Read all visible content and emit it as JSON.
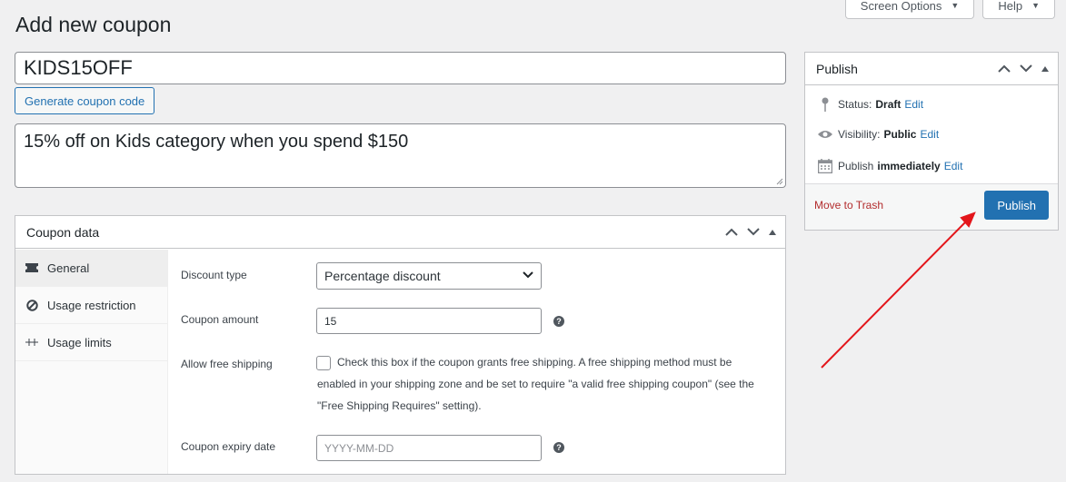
{
  "screen_meta": {
    "screen_options": "Screen Options",
    "help": "Help"
  },
  "page": {
    "title": "Add new coupon"
  },
  "coupon": {
    "code": "KIDS15OFF",
    "generate_label": "Generate coupon code",
    "description": "15% off on Kids category when you spend $150"
  },
  "coupon_data": {
    "title": "Coupon data",
    "tabs": [
      {
        "label": "General",
        "icon": "ticket-icon"
      },
      {
        "label": "Usage restriction",
        "icon": "prohibited-icon"
      },
      {
        "label": "Usage limits",
        "icon": "limits-icon"
      }
    ],
    "fields": {
      "discount_type": {
        "label": "Discount type",
        "value": "Percentage discount"
      },
      "coupon_amount": {
        "label": "Coupon amount",
        "value": "15"
      },
      "free_shipping": {
        "label": "Allow free shipping",
        "text": "Check this box if the coupon grants free shipping. A free shipping method must be enabled in your shipping zone and be set to require \"a valid free shipping coupon\" (see the \"Free Shipping Requires\" setting)."
      },
      "expiry": {
        "label": "Coupon expiry date",
        "placeholder": "YYYY-MM-DD"
      }
    }
  },
  "publish_box": {
    "title": "Publish",
    "status_label": "Status:",
    "status_value": "Draft",
    "visibility_label": "Visibility:",
    "visibility_value": "Public",
    "publish_label": "Publish",
    "publish_value": "immediately",
    "edit": "Edit",
    "trash": "Move to Trash",
    "button": "Publish"
  },
  "colors": {
    "accent": "#2271b1",
    "danger": "#b32d2e",
    "annotation": "#e3161b"
  }
}
